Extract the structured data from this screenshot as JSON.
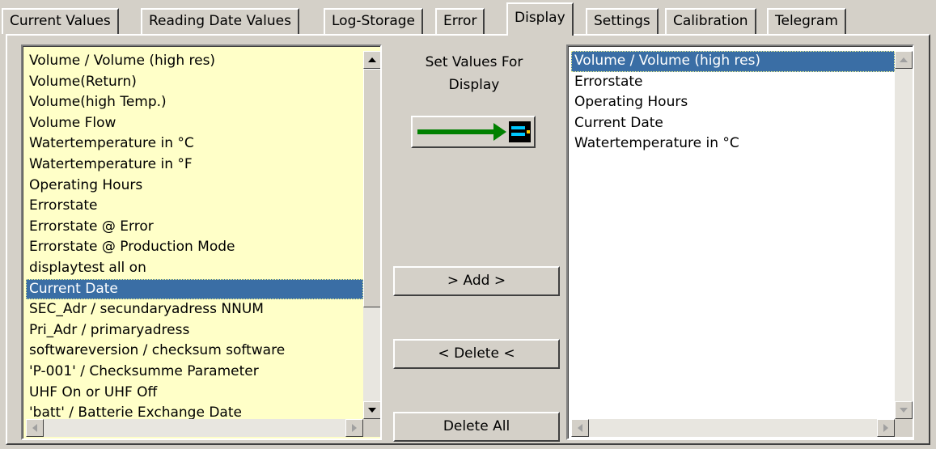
{
  "tabs": [
    {
      "label": "Current Values"
    },
    {
      "label": "Reading Date Values"
    },
    {
      "label": "Log-Storage"
    },
    {
      "label": "Error"
    },
    {
      "label": "Display",
      "active": true
    },
    {
      "label": "Settings"
    },
    {
      "label": "Calibration"
    },
    {
      "label": "Telegram"
    }
  ],
  "available": {
    "items": [
      "Volume / Volume (high res)",
      "Volume(Return)",
      "Volume(high Temp.)",
      "Volume Flow",
      "Watertemperature in °C",
      "Watertemperature in °F",
      "Operating Hours",
      "Errorstate",
      "Errorstate @ Error",
      "Errorstate @ Production Mode",
      "displaytest all on",
      "Current Date",
      "SEC_Adr / secundaryadress NNUM",
      "Pri_Adr / primaryadress",
      "softwareversion / checksum software",
      "'P-001' / Checksumme Parameter",
      "UHF On or UHF Off",
      "'batt' / Batterie Exchange Date"
    ],
    "selected_index": 11
  },
  "middle": {
    "caption_line1": "Set Values For",
    "caption_line2": "Display",
    "add_label": "> Add >",
    "delete_label": "< Delete <",
    "delete_all_label": "Delete All"
  },
  "display": {
    "items": [
      "Volume / Volume (high res)",
      "Errorstate",
      "Operating Hours",
      "Current Date",
      "Watertemperature in °C"
    ],
    "selected_index": 0
  },
  "colors": {
    "available_bg": "#ffffc8",
    "selection": "#3a6ea5",
    "arrow_green": "#008000"
  }
}
